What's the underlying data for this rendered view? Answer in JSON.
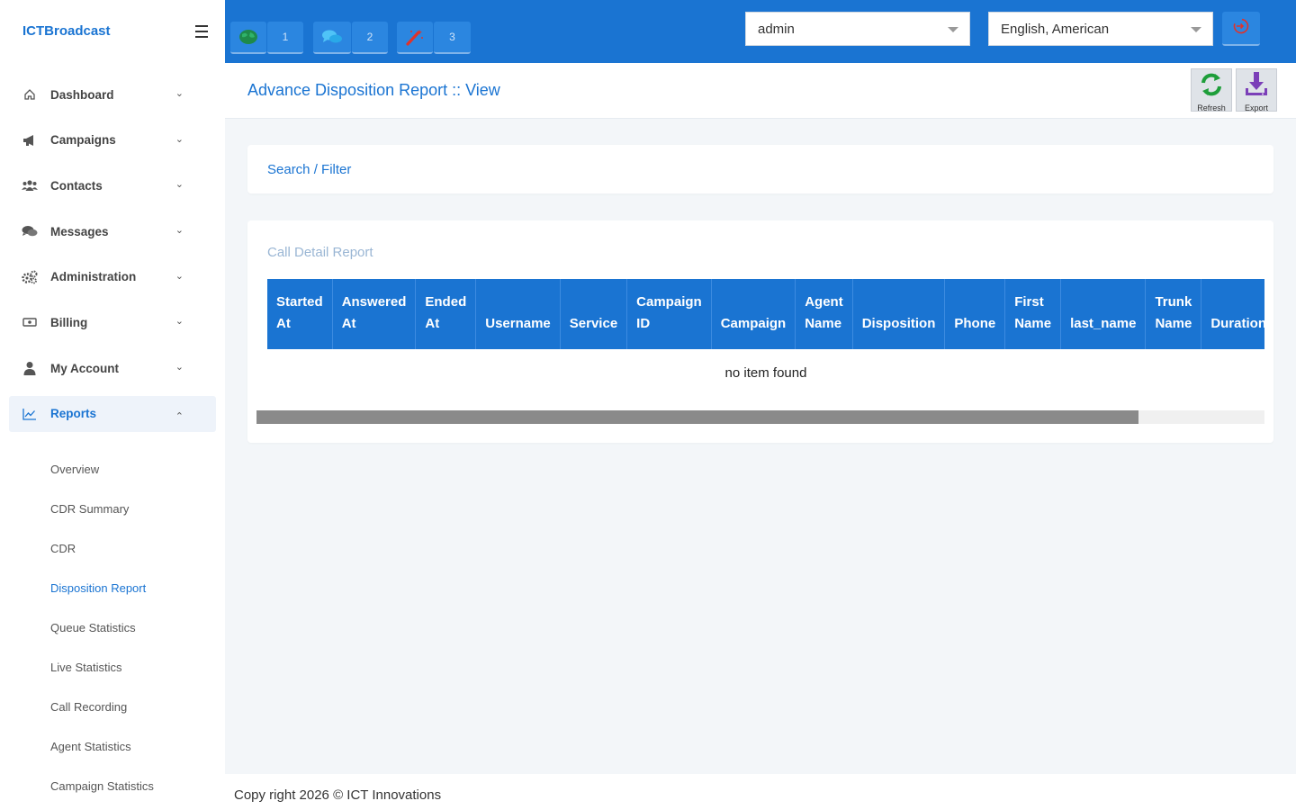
{
  "brand": "ICTBroadcast",
  "nav": [
    {
      "label": "Dashboard",
      "icon": "home-icon",
      "expanded": false
    },
    {
      "label": "Campaigns",
      "icon": "megaphone-icon",
      "expanded": false
    },
    {
      "label": "Contacts",
      "icon": "users-icon",
      "expanded": false
    },
    {
      "label": "Messages",
      "icon": "comments-icon",
      "expanded": false
    },
    {
      "label": "Administration",
      "icon": "gears-icon",
      "expanded": false
    },
    {
      "label": "Billing",
      "icon": "money-icon",
      "expanded": false
    },
    {
      "label": "My Account",
      "icon": "user-icon",
      "expanded": false
    },
    {
      "label": "Reports",
      "icon": "chart-line-icon",
      "expanded": true
    }
  ],
  "reports_sub": [
    "Overview",
    "CDR Summary",
    "CDR",
    "Disposition Report",
    "Queue Statistics",
    "Live Statistics",
    "Call Recording",
    "Agent Statistics",
    "Campaign Statistics"
  ],
  "reports_current": "Disposition Report",
  "topbar": {
    "badges": [
      {
        "icon": "globe-icon",
        "count": "1"
      },
      {
        "icon": "comments-icon",
        "count": "2"
      },
      {
        "icon": "magic-wand-icon",
        "count": "3"
      }
    ],
    "user_select": "admin",
    "language_select": "English, American"
  },
  "page": {
    "title": "Advance Disposition Report :: View",
    "refresh_label": "Refresh",
    "export_label": "Export"
  },
  "filter": {
    "label": "Search / Filter"
  },
  "report": {
    "title": "Call Detail Report",
    "columns": [
      [
        "Started",
        "At"
      ],
      [
        "Answered",
        "At"
      ],
      [
        "Ended",
        "At"
      ],
      [
        "",
        "Username"
      ],
      [
        "",
        "Service"
      ],
      [
        "Campaign",
        "ID"
      ],
      [
        "",
        "Campaign"
      ],
      [
        "Agent",
        "Name"
      ],
      [
        "",
        "Disposition"
      ],
      [
        "",
        "Phone"
      ],
      [
        "First",
        "Name"
      ],
      [
        "",
        "last_name"
      ],
      [
        "Trunk",
        "Name"
      ],
      [
        "",
        "Duration"
      ]
    ],
    "empty_message": "no item found",
    "scroll_fraction": 0.875
  },
  "footer": "Copy right 2026 © ICT Innovations",
  "colors": {
    "primary": "#1a74d2",
    "refresh_green": "#1e9e3a",
    "export_purple": "#7b3fb8",
    "logout_red": "#e0322a"
  }
}
